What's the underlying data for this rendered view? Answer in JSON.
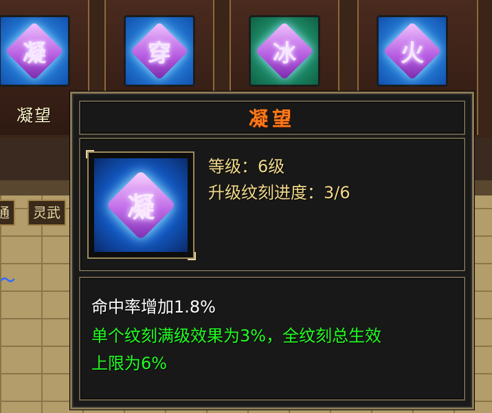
{
  "skill_slots": [
    {
      "glyph": "凝",
      "name": "凝望",
      "bg": "#1e7ad8"
    },
    {
      "glyph": "穿",
      "name": "",
      "bg": "#1e7ad8"
    },
    {
      "glyph": "冰",
      "name": "",
      "bg": "#1f8a6a"
    },
    {
      "glyph": "火",
      "name": "",
      "bg": "#1e6ad0"
    }
  ],
  "side_tabs": [
    "通",
    "灵武"
  ],
  "tooltip": {
    "title": "凝望",
    "icon_glyph": "凝",
    "level_line": "等级：6级",
    "progress_line": "升级纹刻进度：3/6",
    "effect_line": "命中率增加1.8%",
    "bonus_line_1": "单个纹刻满级效果为3%，全纹刻总生效",
    "bonus_line_2": "上限为6%"
  },
  "colors": {
    "title": "#ff7a1a",
    "stat": "#f2d98a",
    "bonus": "#22ff22"
  }
}
